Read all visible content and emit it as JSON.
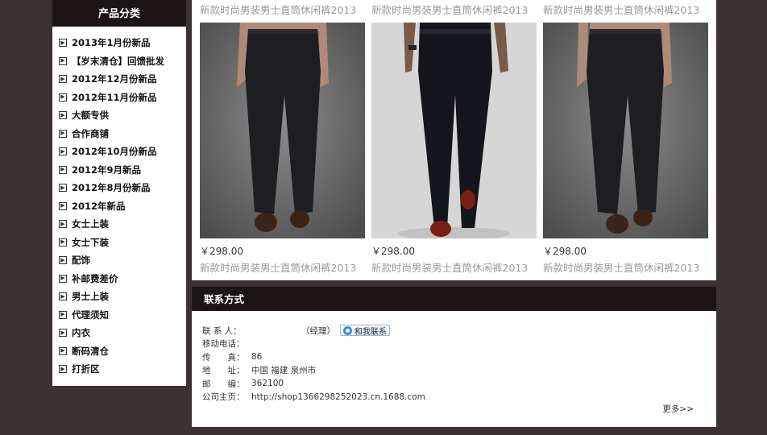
{
  "sidebar": {
    "title": "产品分类",
    "items": [
      "2013年1月份新品",
      "【岁末清仓】回馈批发",
      "2012年12月份新品",
      "2012年11月份新品",
      "大额专供",
      "合作商铺",
      "2012年10月份新品",
      "2012年9月新品",
      "2012年8月份新品",
      "2012年新品",
      "女士上装",
      "女士下装",
      "配饰",
      "补邮费差价",
      "男士上装",
      "代理须知",
      "内衣",
      "断码清仓",
      "打折区"
    ]
  },
  "products": [
    {
      "top_title": "新款时尚男装男士直筒休闲裤2013",
      "price": "￥298.00",
      "title": "新款时尚男装男士直筒休闲裤2013"
    },
    {
      "top_title": "新款时尚男装男士直筒休闲裤2013",
      "price": "￥298.00",
      "title": "新款时尚男装男士直筒休闲裤2013"
    },
    {
      "top_title": "新款时尚男装男士直筒休闲裤2013",
      "price": "￥298.00",
      "title": "新款时尚男装男士直筒休闲裤2013"
    }
  ],
  "contact": {
    "title": "联系方式",
    "person_label": "联 系 人：",
    "person_value": "（经理）",
    "chat_button": "和我联系",
    "mobile_label": "移动电话：",
    "mobile_value": "",
    "fax_label": "传　　真：",
    "fax_value": "86",
    "address_label": "地　　址：",
    "address_value": "中国 福建 泉州市",
    "zip_label": "邮　　编：",
    "zip_value": "362100",
    "homepage_label": "公司主页：",
    "homepage_value": "http://shop1366298252023.cn.1688.com",
    "more": "更多>>"
  }
}
